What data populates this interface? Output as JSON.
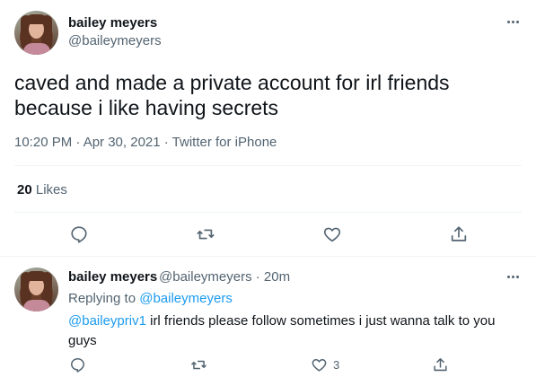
{
  "main_tweet": {
    "display_name": "bailey meyers",
    "handle": "@baileymeyers",
    "text": "caved and made a private account for irl friends because i like having secrets",
    "timestamp": "10:20 PM · Apr 30, 2021 · Twitter for iPhone",
    "likes_count": "20",
    "likes_label": "Likes"
  },
  "reply_tweet": {
    "display_name": "bailey meyers",
    "handle_time": "@baileymeyers · 20m",
    "replying_prefix": "Replying to",
    "replying_to": "@baileymeyers",
    "mention": "@baileypriv1",
    "text": " irl friends please follow sometimes i just wanna talk to you guys",
    "like_count": "3"
  },
  "icons": {
    "reply": "reply-icon",
    "retweet": "retweet-icon",
    "like": "heart-icon",
    "share": "share-icon",
    "more": "more-icon"
  },
  "colors": {
    "text": "#0f1419",
    "secondary": "#536471",
    "link": "#1d9bf0",
    "divider": "#eff3f4"
  }
}
